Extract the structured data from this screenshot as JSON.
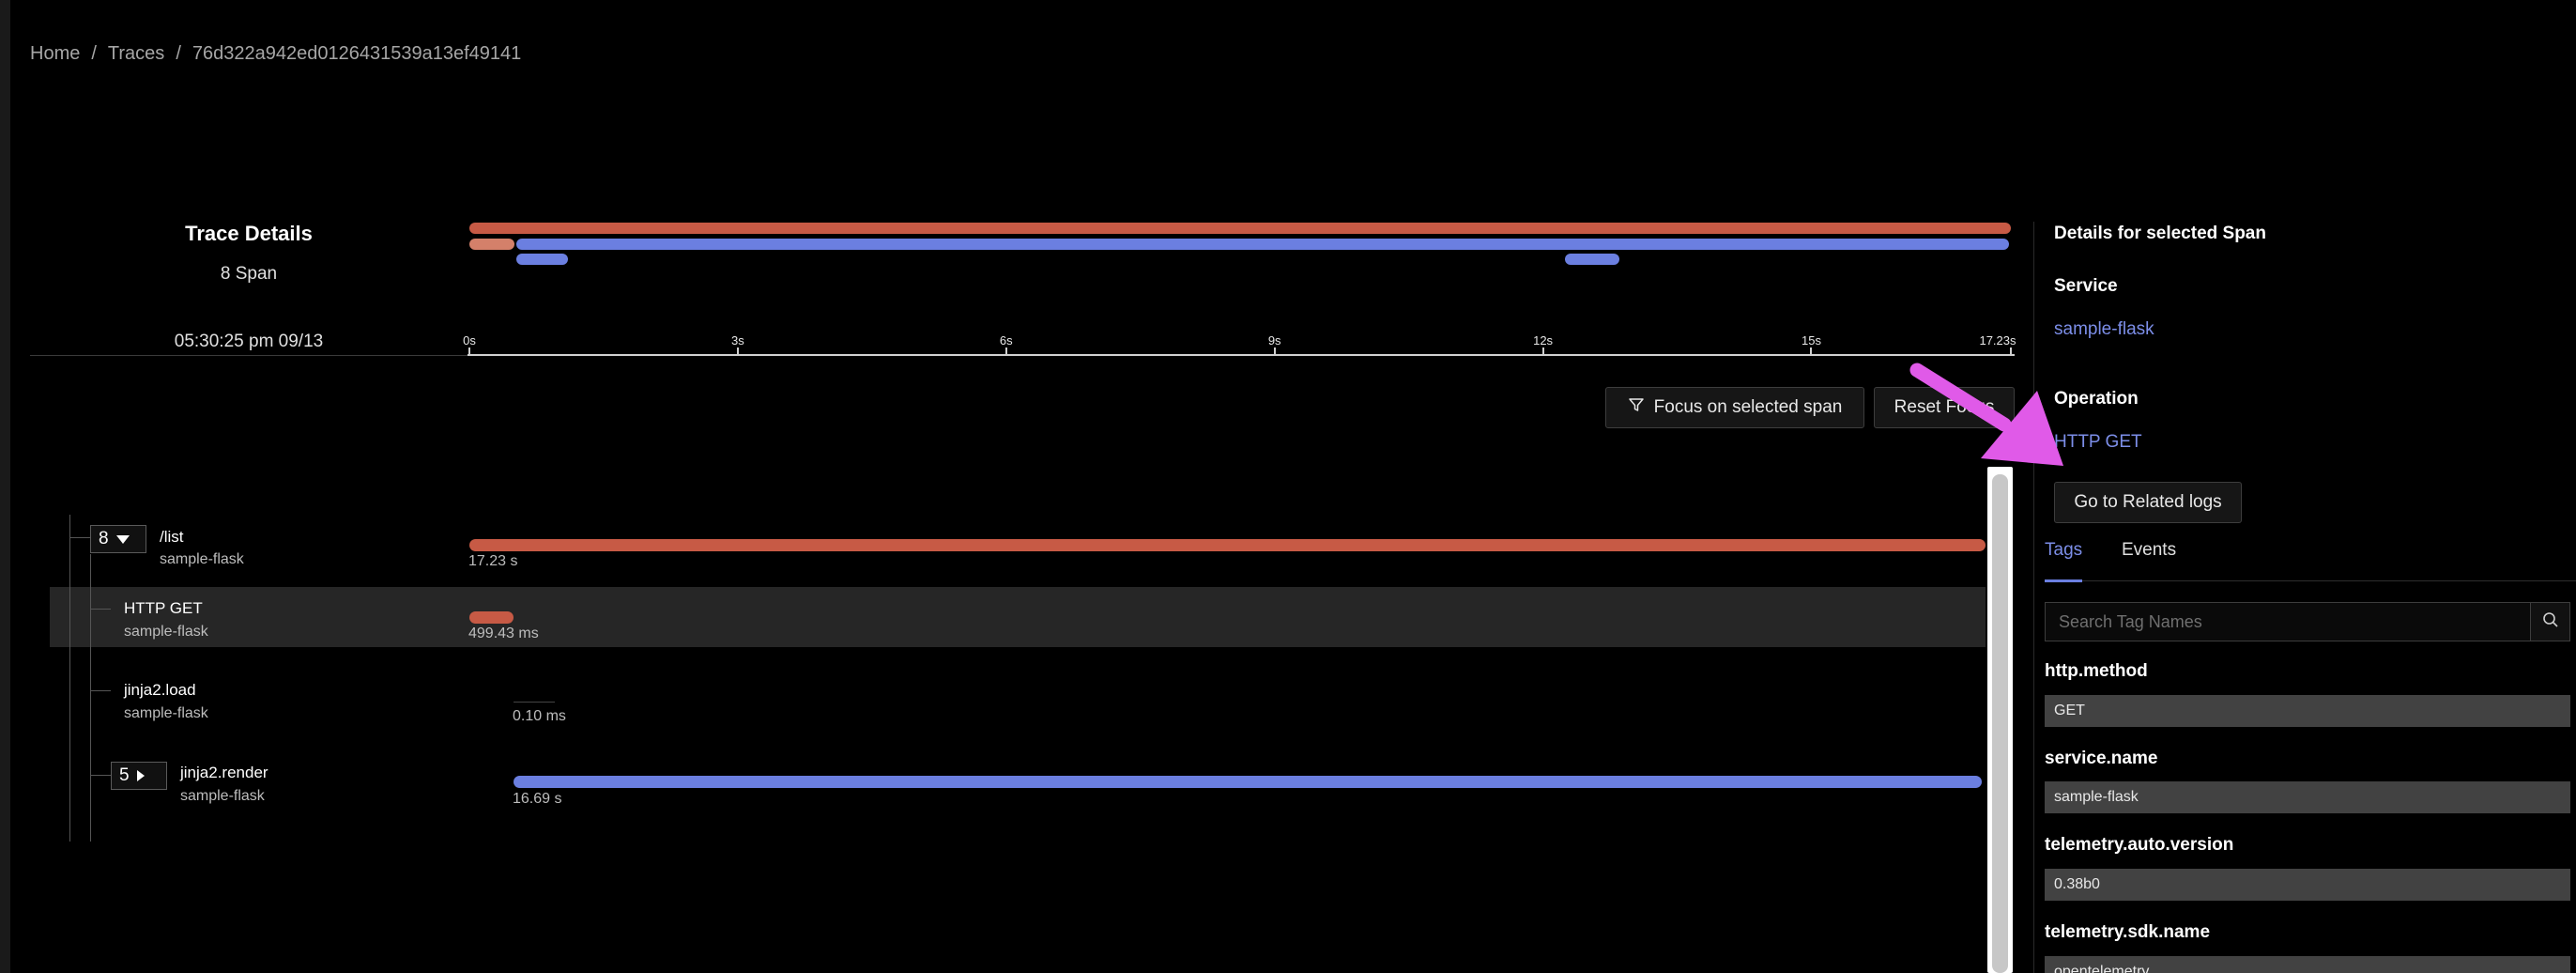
{
  "breadcrumb": {
    "home": "Home",
    "traces": "Traces",
    "trace_id": "76d322a942ed0126431539a13ef49141",
    "separator": "/"
  },
  "trace_details": {
    "title": "Trace Details",
    "span_count": "8 Span",
    "timestamp": "05:30:25 pm 09/13"
  },
  "timeline": {
    "ticks": [
      "0s",
      "3s",
      "6s",
      "9s",
      "12s",
      "15s",
      "17.23s"
    ],
    "total_seconds": 17.23
  },
  "overview_bars": [
    {
      "row": 0,
      "start_s": 0,
      "end_s": 17.23,
      "color": "#c75a45"
    },
    {
      "row": 1,
      "start_s": 0,
      "end_s": 0.5,
      "color": "#d4806a"
    },
    {
      "row": 1,
      "start_s": 0.52,
      "end_s": 17.21,
      "color": "#6b7fe0"
    },
    {
      "row": 2,
      "start_s": 0.52,
      "end_s": 1.1,
      "color": "#6b7fe0"
    },
    {
      "row": 2,
      "start_s": 12.25,
      "end_s": 12.85,
      "color": "#6b7fe0"
    }
  ],
  "buttons": {
    "focus": "Focus on selected span",
    "reset": "Reset Focus",
    "related_logs": "Go to Related logs"
  },
  "spans": [
    {
      "count": "8",
      "name": "/list",
      "service": "sample-flask",
      "duration": "17.23 s",
      "start_s": 0,
      "end_s": 17.23,
      "color": "#c75a45"
    },
    {
      "name": "HTTP GET",
      "service": "sample-flask",
      "duration": "499.43 ms",
      "start_s": 0,
      "end_s": 0.5,
      "color": "#c75a45"
    },
    {
      "name": "jinja2.load",
      "service": "sample-flask",
      "duration": "0.10 ms",
      "start_s": 0.5,
      "end_s": 0.5001,
      "color": "#6b7fe0"
    },
    {
      "count": "5",
      "name": "jinja2.render",
      "service": "sample-flask",
      "duration": "16.69 s",
      "start_s": 0.5,
      "end_s": 17.19,
      "color": "#6b7fe0"
    }
  ],
  "panel": {
    "title": "Details for selected Span",
    "service_label": "Service",
    "service_value": "sample-flask",
    "operation_label": "Operation",
    "operation_value": "HTTP GET",
    "tabs": [
      "Tags",
      "Events"
    ],
    "search_placeholder": "Search Tag Names",
    "tags": [
      {
        "key": "http.method",
        "value": "GET"
      },
      {
        "key": "service.name",
        "value": "sample-flask"
      },
      {
        "key": "telemetry.auto.version",
        "value": "0.38b0"
      },
      {
        "key": "telemetry.sdk.name",
        "value": "opentelemetry"
      }
    ]
  },
  "icons": {
    "filter": "filter-icon",
    "search": "search-icon",
    "arrow": "pointer-arrow-icon"
  },
  "colors": {
    "accent": "#6b7fe0",
    "error_span": "#c75a45",
    "annotation_arrow": "#e05ae8"
  }
}
